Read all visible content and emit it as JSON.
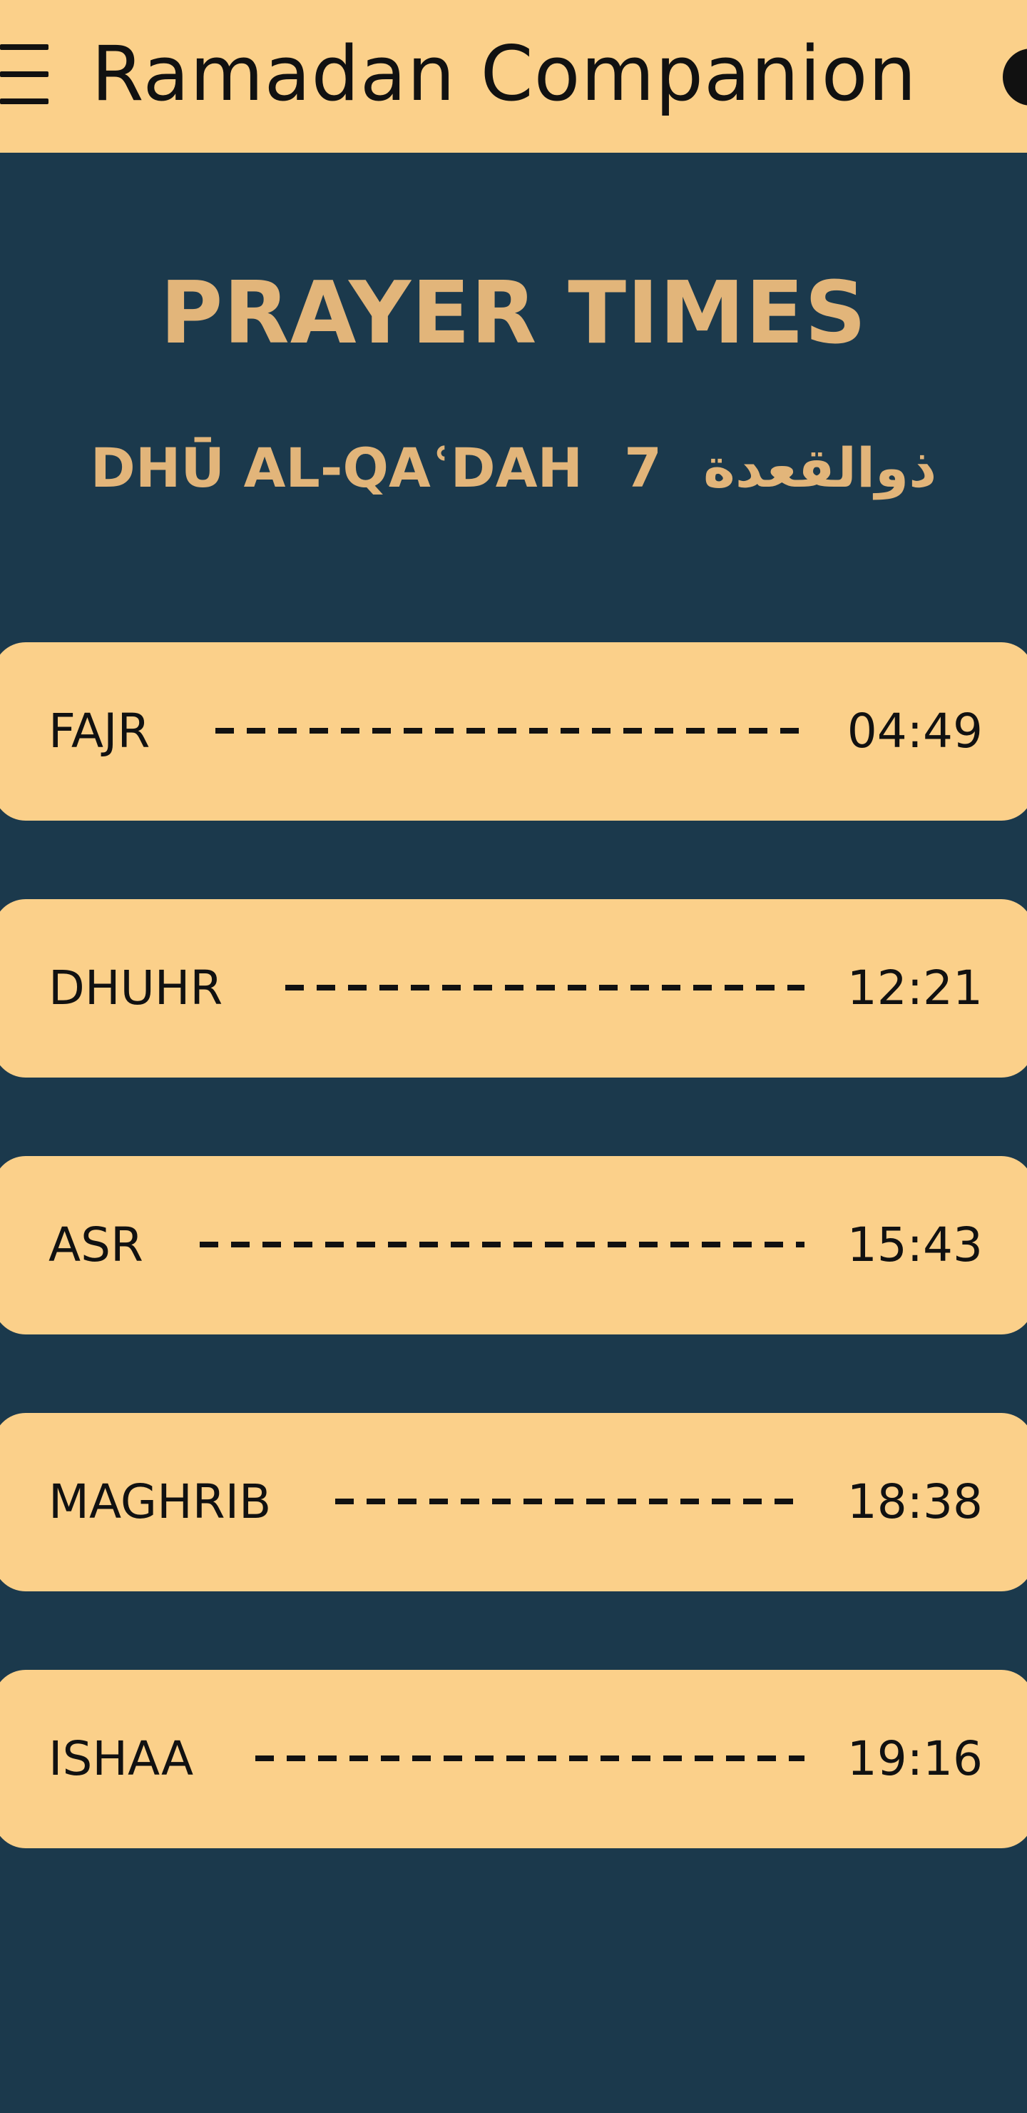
{
  "header": {
    "title": "Ramadan Companion",
    "menu_icon": "hamburger-menu-icon",
    "toggle_icon": "theme-toggle-icon"
  },
  "main": {
    "title": "PRAYER TIMES",
    "hijri_date": {
      "month_latin": "DHŪ AL-QAʿDAH",
      "day": "7",
      "month_arabic": "ذوالقعدة"
    },
    "prayers": [
      {
        "name": "FAJR",
        "time": "04:49"
      },
      {
        "name": "DHUHR",
        "time": "12:21"
      },
      {
        "name": "ASR",
        "time": "15:43"
      },
      {
        "name": "MAGHRIB",
        "time": "18:38"
      },
      {
        "name": "ISHAA",
        "time": "19:16"
      }
    ]
  },
  "colors": {
    "background": "#1b394c",
    "header": "#fbd08a",
    "card": "#fbd08a",
    "accent_text": "#e2b57a",
    "text": "#111111"
  }
}
